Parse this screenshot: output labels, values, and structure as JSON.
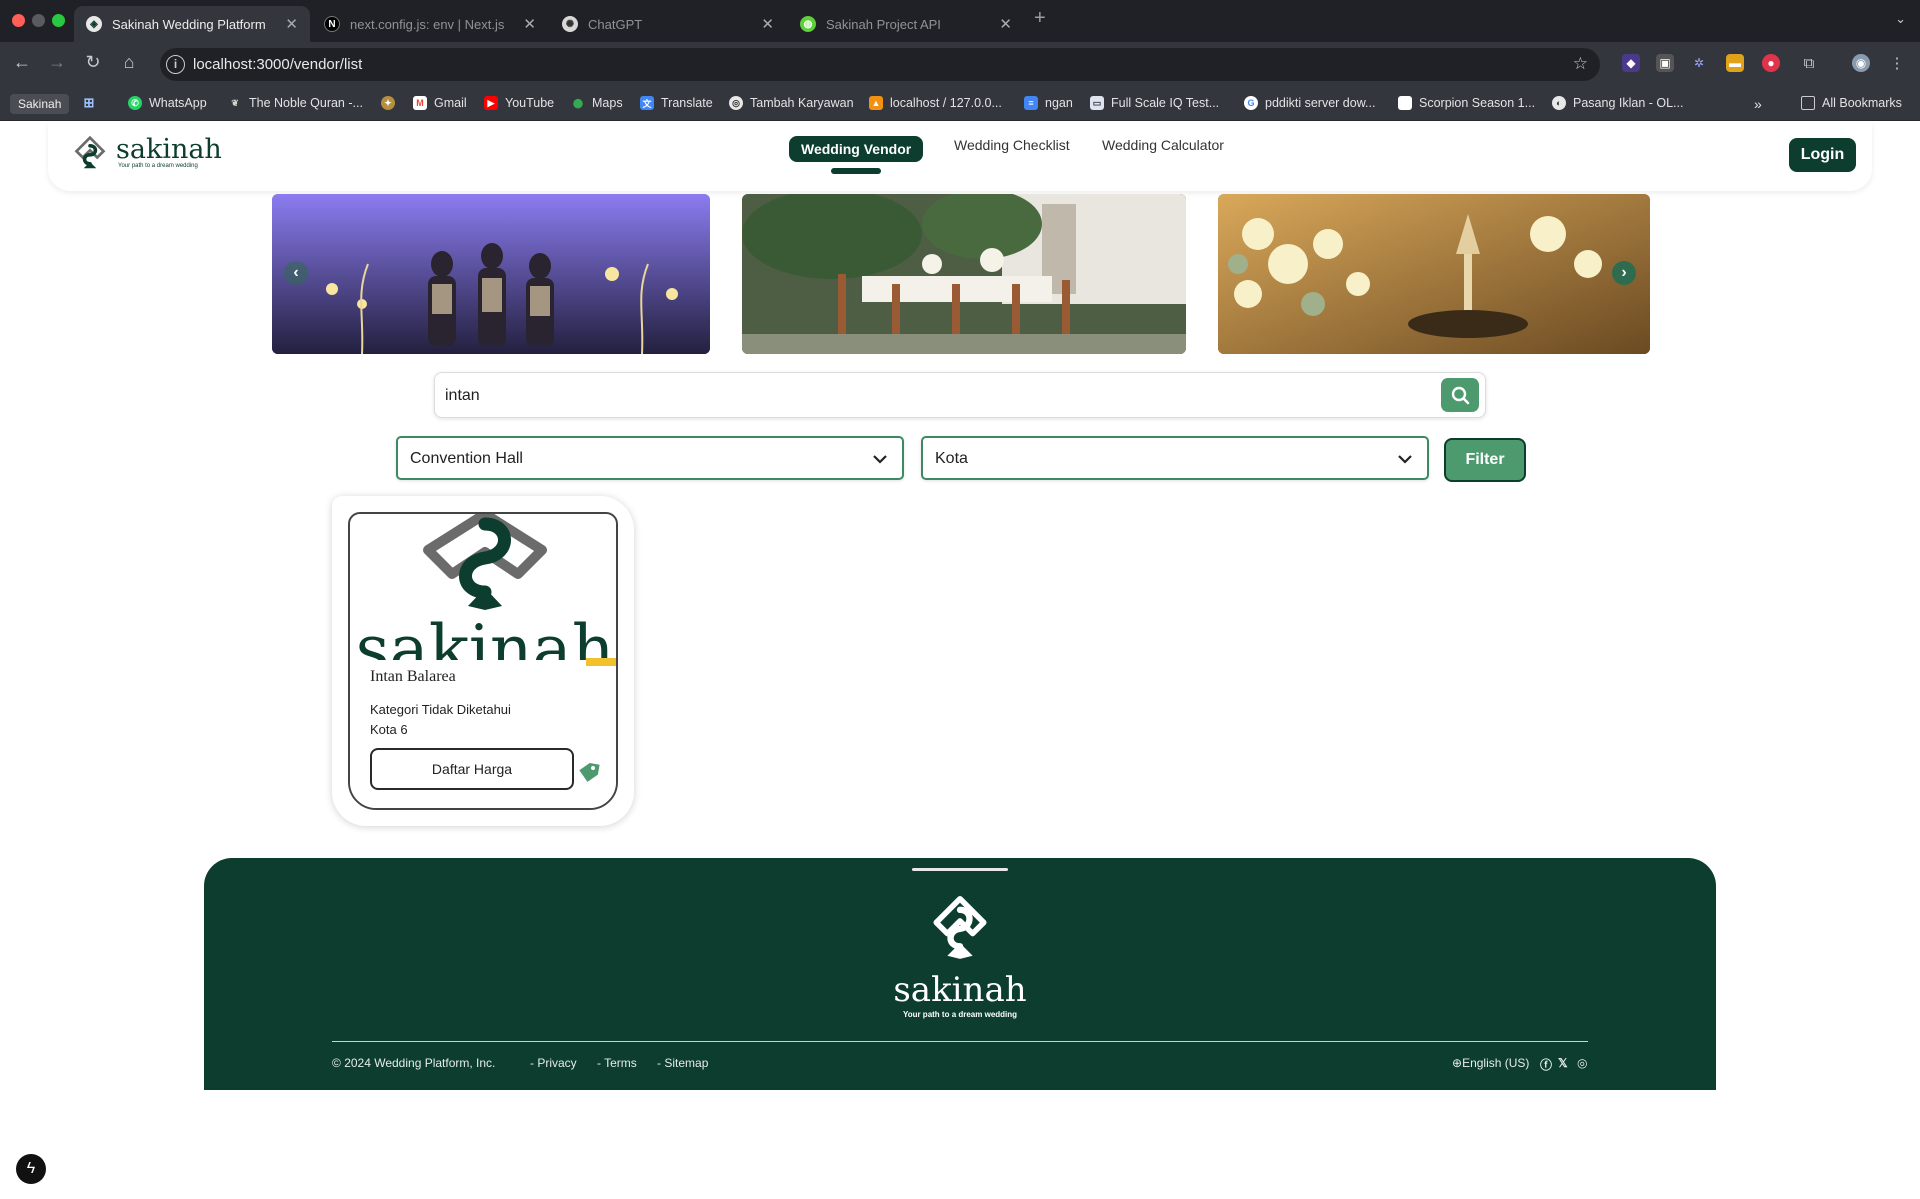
{
  "browser": {
    "tabs": [
      {
        "title": "Sakinah Wedding Platform",
        "favicon": "S",
        "active": true
      },
      {
        "title": "next.config.js: env | Next.js",
        "favicon": "N",
        "active": false
      },
      {
        "title": "ChatGPT",
        "favicon": "G",
        "active": false
      },
      {
        "title": "Sakinah Project API",
        "favicon": "S",
        "active": false
      }
    ],
    "url": "localhost:3000/vendor/list",
    "bookmarks": [
      {
        "label": "Sakinah"
      },
      {
        "label": "WhatsApp"
      },
      {
        "label": "The Noble Quran -..."
      },
      {
        "label": "Gmail"
      },
      {
        "label": "YouTube"
      },
      {
        "label": "Maps"
      },
      {
        "label": "Translate"
      },
      {
        "label": "Tambah Karyawan"
      },
      {
        "label": "localhost / 127.0.0..."
      },
      {
        "label": "ngan"
      },
      {
        "label": "Full Scale IQ Test..."
      },
      {
        "label": "pddikti server dow..."
      },
      {
        "label": "Scorpion Season 1..."
      },
      {
        "label": "Pasang Iklan - OL..."
      },
      {
        "label": "All Bookmarks"
      }
    ]
  },
  "header": {
    "logo_name": "sakinah",
    "logo_tagline": "Your path to a dream wedding",
    "nav": [
      {
        "label": "Wedding Vendor",
        "active": true
      },
      {
        "label": "Wedding Checklist",
        "active": false
      },
      {
        "label": "Wedding Calculator",
        "active": false
      }
    ],
    "login_label": "Login"
  },
  "carousel": {
    "slides": [
      "performers-stage",
      "outdoor-table-setting",
      "floral-centerpiece"
    ]
  },
  "search": {
    "value": "intan"
  },
  "filters": {
    "category": "Convention Hall",
    "city": "Kota",
    "button_label": "Filter"
  },
  "vendors": [
    {
      "logo_text": "sakinah",
      "name": "Intan Balarea",
      "category": "Kategori Tidak Diketahui",
      "city": "Kota 6",
      "price_button": "Daftar Harga"
    }
  ],
  "footer": {
    "logo_name": "sakinah",
    "tagline": "Your path to a dream wedding",
    "copyright": "2024 Wedding Platform, Inc.",
    "links": [
      "Privacy",
      "Terms",
      "Sitemap"
    ],
    "language": "English (US)"
  },
  "colors": {
    "brand_dark": "#0c3d2e",
    "brand_green": "#4c9a6e",
    "accent_yellow": "#f2c12e"
  }
}
